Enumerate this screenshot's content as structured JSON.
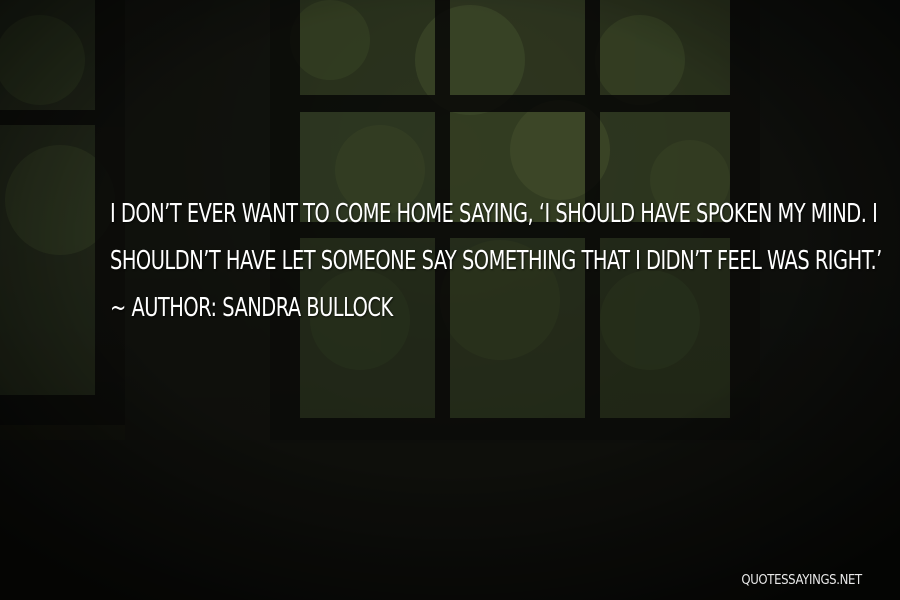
{
  "quote": {
    "lines": [
      "I DON’T EVER WANT TO COME HOME SAYING, ‘I SHOULD HAVE SPOKEN MY MIND. I",
      "SHOULDN’T HAVE LET SOMEONE SAY SOMETHING THAT I DIDN’T FEEL WAS RIGHT.’"
    ],
    "author_line": "~ AUTHOR: SANDRA BULLOCK"
  },
  "watermark": "QUOTESSAYINGS.NET",
  "colors": {
    "text": "#ffffff",
    "background_dark": "#151611",
    "window_frame": "#0d0e0a",
    "foliage": "#3b4a2a"
  }
}
